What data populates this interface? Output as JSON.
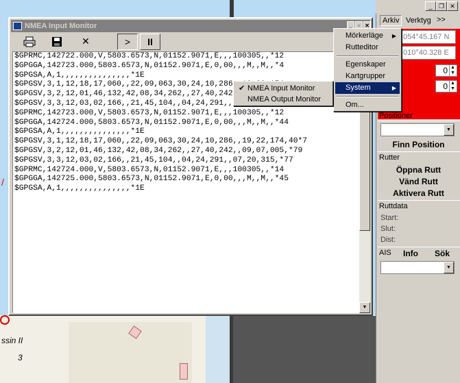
{
  "nmea_window": {
    "title": "NMEA Input Monitor",
    "toolbar": {
      "print_icon": "printer-icon",
      "save_icon": "floppy-icon",
      "close_label": "✕",
      "play_label": ">",
      "pause_label": "II"
    },
    "lines": [
      "$GPRMC,142722.000,V,5803.6573,N,01152.9071,E,,,100305,,*12",
      "$GPGGA,142723.000,5803.6573,N,01152.9071,E,0,00,,,M,,M,,*4",
      "$GPGSA,A,1,,,,,,,,,,,,,,,*1E",
      "$GPGSV,3,1,12,18,17,060,,22,09,063,30,24,10,286,,19,22,174",
      "$GPGSV,3,2,12,01,46,132,42,08,34,262,,27,40,242,,09,07,005",
      "$GPGSV,3,3,12,03,02,166,,21,45,104,,04,24,291,,07,20,315,",
      "$GPRMC,142723.000,V,5803.6573,N,01152.9071,E,,,100305,,*12",
      "$GPGGA,142724.000,5803.6573,N,01152.9071,E,0,00,,,M,,M,,*44",
      "$GPGSA,A,1,,,,,,,,,,,,,,,*1E",
      "$GPGSV,3,1,12,18,17,060,,22,09,063,30,24,10,286,,19,22,174,40*7",
      "$GPGSV,3,2,12,01,46,132,42,08,34,262,,27,40,242,,09,07,005,*79",
      "$GPGSV,3,3,12,03,02,166,,21,45,104,,04,24,291,,07,20,315,*77",
      "$GPRMC,142724.000,V,5803.6573,N,01152.9071,E,,,100305,,*14",
      "$GPGGA,142725.000,5803.6573,N,01152.9071,E,0,00,,,M,,M,,*45",
      "$GPGSA,A,1,,,,,,,,,,,,,,,*1E"
    ]
  },
  "menubar": {
    "arkiv": "Arkiv",
    "verktyg": "Verktyg",
    "more": ">>"
  },
  "menu_main": {
    "items": [
      "Mörkerläge",
      "Rutteditor",
      "Egenskaper",
      "Kartgrupper",
      "System",
      "Om..."
    ]
  },
  "menu_system": {
    "items": [
      "NMEA Input Monitor",
      "NMEA Output Monitor"
    ],
    "checked": "✔"
  },
  "panel": {
    "lat": "054°45.167 N",
    "lon": "010°40.328 E",
    "spin1": "0",
    "spin2": "0",
    "positioner_label": "Positioner",
    "finn_position": "Finn Position",
    "rutter_label": "Rutter",
    "oppna_rutt": "Öppna Rutt",
    "vand_rutt": "Vänd Rutt",
    "aktivera_rutt": "Aktivera Rutt",
    "ruttdata_label": "Ruttdata",
    "start": "Start:",
    "slut": "Slut:",
    "dist": "Dist:",
    "ais": "AIS",
    "info": "Info",
    "sok": "Sök"
  },
  "chart_labels": {
    "name": "ssin II",
    "num": "3"
  },
  "colors": {
    "chart_water": "#b9dbf3",
    "panel_red": "#ee0000",
    "highlight": "#0a246a"
  }
}
